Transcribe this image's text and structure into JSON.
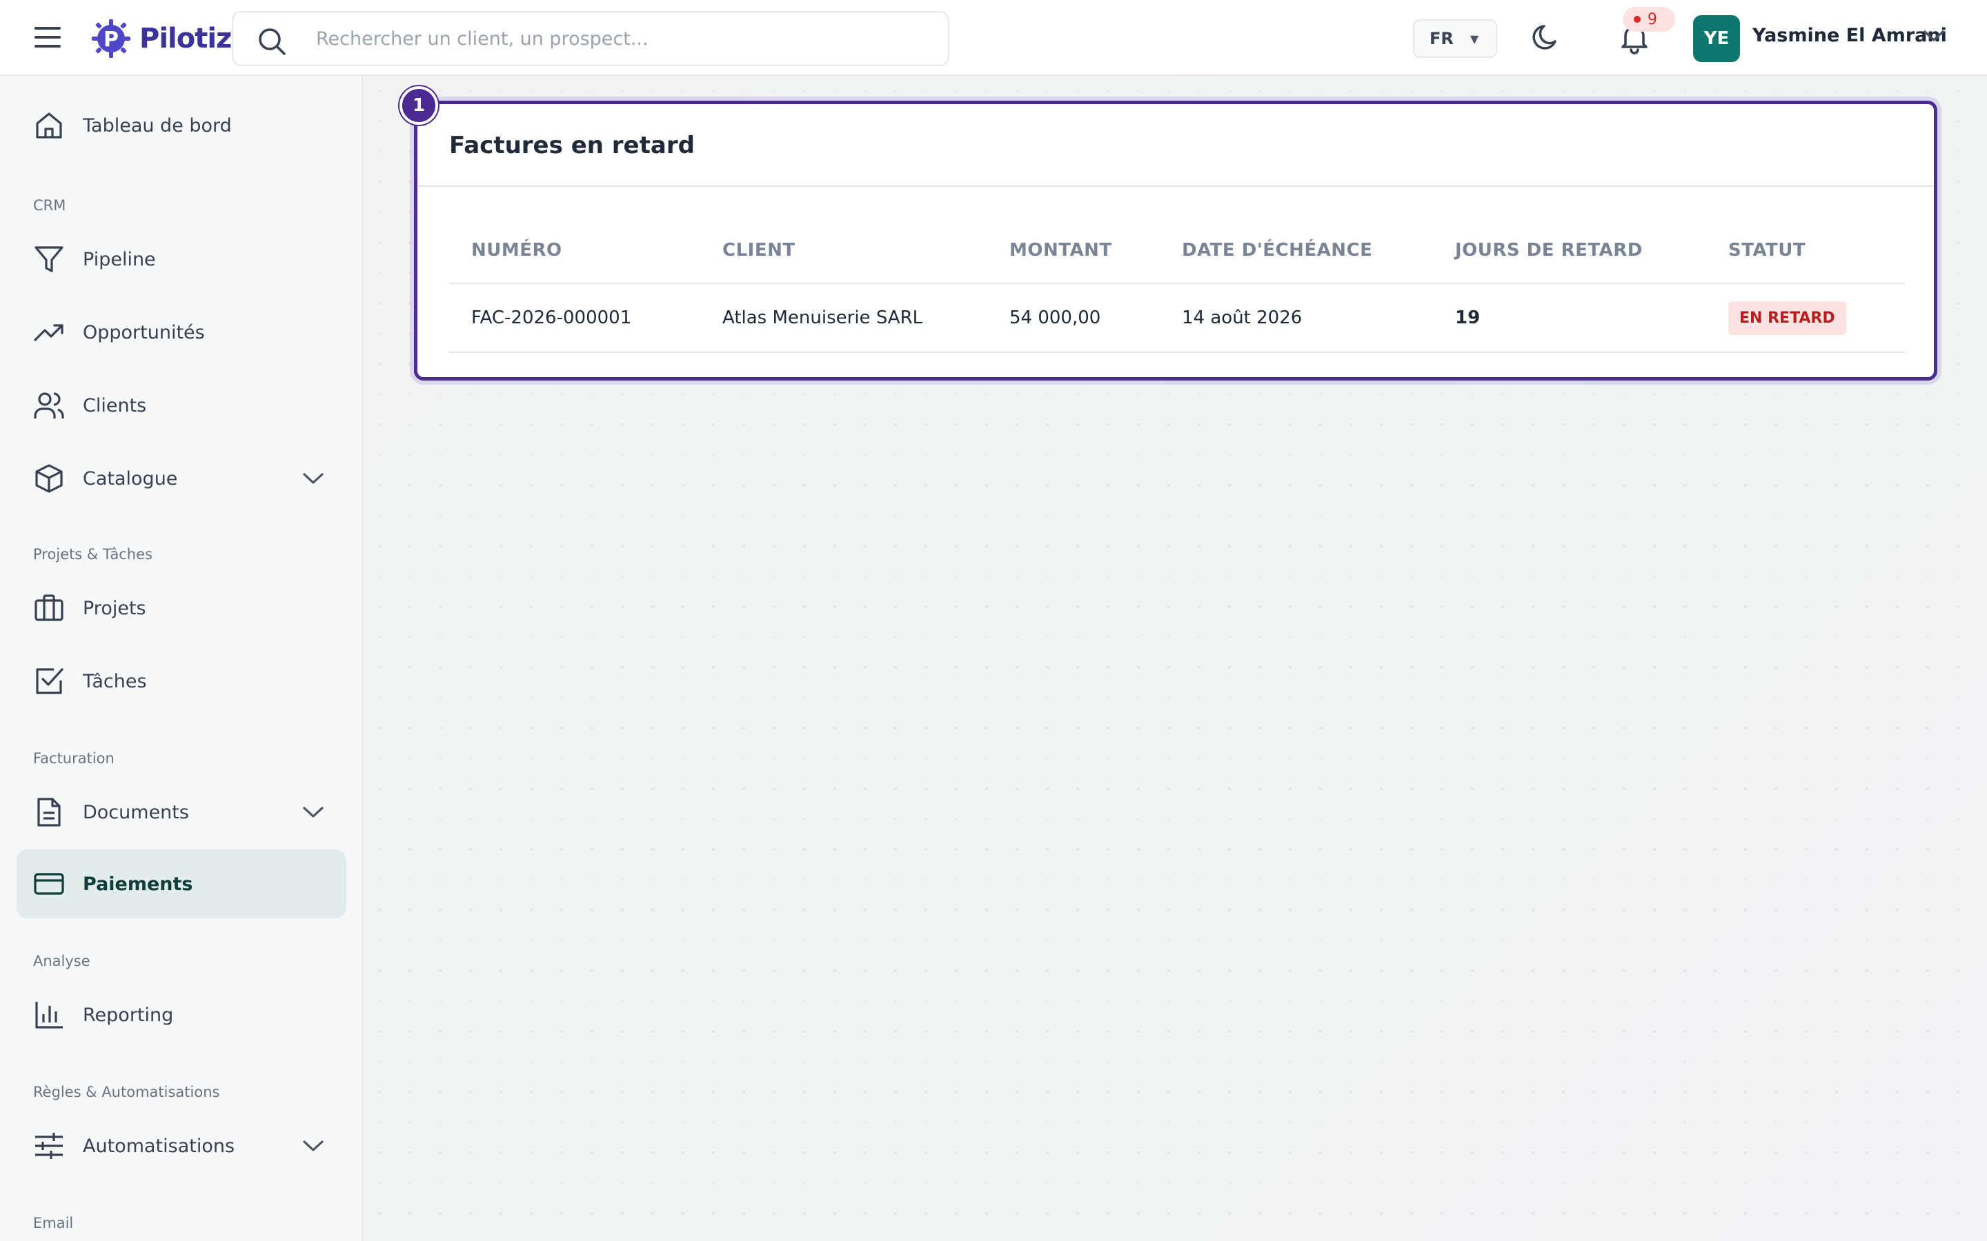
{
  "app": {
    "name": "Pilotiz"
  },
  "header": {
    "search_placeholder": "Rechercher un client, un prospect...",
    "language": "FR",
    "notifications_count": "9",
    "user": {
      "initials": "YE",
      "name": "Yasmine El Amrani"
    }
  },
  "sidebar": {
    "items": [
      {
        "label": "Tableau de bord",
        "icon": "home-icon"
      },
      {
        "section": "CRM"
      },
      {
        "label": "Pipeline",
        "icon": "filter-icon"
      },
      {
        "label": "Opportunités",
        "icon": "trending-up-icon"
      },
      {
        "label": "Clients",
        "icon": "users-icon"
      },
      {
        "label": "Catalogue",
        "icon": "box-icon",
        "expandable": true
      },
      {
        "section": "Projets & Tâches"
      },
      {
        "label": "Projets",
        "icon": "briefcase-icon"
      },
      {
        "label": "Tâches",
        "icon": "checkbox-icon"
      },
      {
        "section": "Facturation"
      },
      {
        "label": "Documents",
        "icon": "document-icon",
        "expandable": true
      },
      {
        "label": "Paiements",
        "icon": "credit-card-icon",
        "active": true
      },
      {
        "section": "Analyse"
      },
      {
        "label": "Reporting",
        "icon": "bar-chart-icon"
      },
      {
        "section": "Règles & Automatisations"
      },
      {
        "label": "Automatisations",
        "icon": "sliders-icon",
        "expandable": true
      },
      {
        "section": "Email"
      }
    ]
  },
  "main": {
    "card": {
      "step_badge": "1",
      "title": "Factures en retard",
      "columns": [
        "NUMÉRO",
        "CLIENT",
        "MONTANT",
        "DATE D'ÉCHÉANCE",
        "JOURS DE RETARD",
        "STATUT"
      ],
      "rows": [
        {
          "number": "FAC-2026-000001",
          "client": "Atlas Menuiserie SARL",
          "amount": "54 000,00",
          "due_date": "14 août 2026",
          "days_late": "19",
          "status": "EN RETARD"
        }
      ]
    }
  },
  "colors": {
    "brand": "#3b3399",
    "accent_teal": "#0f766e",
    "card_border": "#4c2a93",
    "late_red": "#dc2626",
    "status_bg": "#fde2e2"
  }
}
